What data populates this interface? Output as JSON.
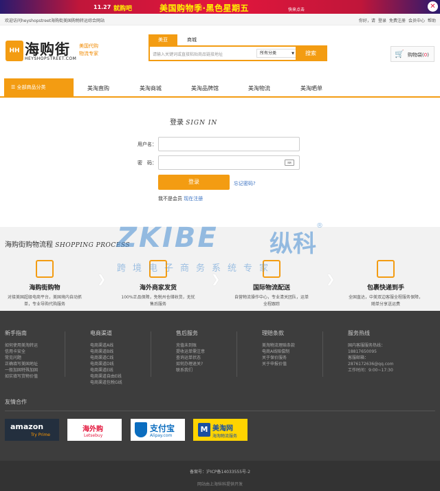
{
  "promo": {
    "date": "11.27",
    "brand": "就购吧",
    "slogan": "美国购物季·黑色星期五",
    "cta": "快来点击",
    "close_glyph": "✕"
  },
  "topbar": {
    "welcome": "欢迎访问heyshopstreet海购街美国购物转运综合网站",
    "links": [
      "你好，请",
      "登录",
      "免费注册",
      "会员中心",
      "帮助"
    ]
  },
  "logo": {
    "mark": "HH",
    "name_cn": "海购街",
    "name_en": "HEYSHOPSTREET.COM",
    "tagline_1": "美国代购",
    "tagline_2": "物流专家"
  },
  "search": {
    "tabs": [
      "美亚",
      "商城"
    ],
    "placeholder": "请输入关键词或直接粘贴商品链接地址",
    "category_selected": "所有分类",
    "button": "搜索"
  },
  "cart": {
    "icon": "cart-icon",
    "label": "购物袋(",
    "count": "0",
    "close_paren": ")"
  },
  "nav": {
    "all_categories": "全部商品分类",
    "items": [
      "美淘直购",
      "美淘商城",
      "美淘品牌馆",
      "美淘物流",
      "美淘晒单"
    ]
  },
  "login": {
    "title": "登录",
    "title_en": "SIGN IN",
    "username_label": "用户名：",
    "password_label": "密　码：",
    "keyboard_glyph": "⌨",
    "submit": "登录",
    "forgot": "忘记密码?",
    "no_account": "我不是会员",
    "register": "现在注册"
  },
  "watermark": {
    "brand": "ZKIBE",
    "cn": "纵科",
    "reg": "®",
    "sub": "跨境电子商务系统专家"
  },
  "process": {
    "title": "海购街购物流程",
    "title_en": "SHOPPING PROCESS",
    "arrow": "❯",
    "steps": [
      {
        "title": "海购街购物",
        "desc": "对接美国超级电商平台，美国境内自动抓单，专业导购代购服务"
      },
      {
        "title": "海外商家发货",
        "desc": "100%正品保障，免税州仓储收货，无忧售后服务"
      },
      {
        "title": "国际物流配送",
        "desc": "自营物流操作中心，专业清关团队，运单全程跟踪"
      },
      {
        "title": "包裹快递到手",
        "desc": "全国直达，中美双边客服全程服务保障，随单分享送运费"
      }
    ]
  },
  "footer": {
    "columns": [
      {
        "title": "新手指南",
        "links": [
          "如何使用美淘转运",
          "信用卡安全",
          "常见问题",
          "正确填写美国地址",
          "一般加固特殊加固",
          "如实填写货物价值"
        ]
      },
      {
        "title": "电商渠道",
        "links": [
          "电商渠道A线",
          "电商渠道B线",
          "电商渠道C线",
          "电商渠道D线",
          "电商渠道E线",
          "电商渠道自由E线",
          "电商渠道包税G线"
        ]
      },
      {
        "title": "售后服务",
        "links": [
          "充值未到账",
          "提收运单需注意",
          "查询运单状态",
          "如何办理退关?",
          "联系我们"
        ]
      },
      {
        "title": "理赔条款",
        "links": [
          "美淘物流理赔条款",
          "电商A线赔偿制",
          "关于保价服务",
          "关于申报价值"
        ]
      },
      {
        "title": "服务热线",
        "links": [
          "国内客服服务热线：",
          "18817650095",
          "客服邮箱：",
          "2876172636@qq.com",
          "工作时间：9:00~17:30"
        ]
      }
    ],
    "friends_title": "友情合作",
    "partners": [
      {
        "line1": "amazon",
        "line2": "Try Prime"
      },
      {
        "line1": "海外购",
        "line2": "Letsebuy"
      },
      {
        "line1": "支付宝",
        "line2": "Alipay.com"
      },
      {
        "line1": "美淘网",
        "line2": "海淘物流服务",
        "mark": "M"
      }
    ],
    "icp": "备案号：沪ICP备14033555号-2",
    "dev": "网站由上海纵科提供开发"
  }
}
